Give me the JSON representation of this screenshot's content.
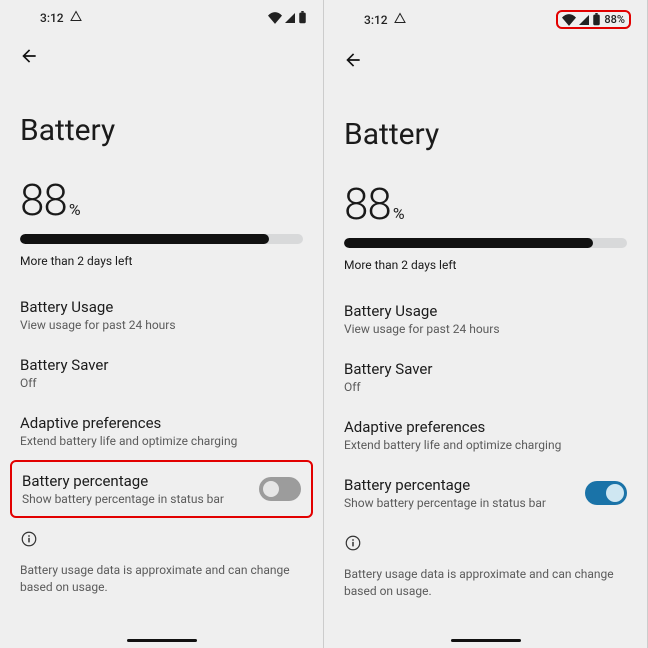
{
  "statusbar": {
    "time": "3:12",
    "battery_pct_text": "88%"
  },
  "page": {
    "title": "Battery",
    "pct_value": "88",
    "pct_symbol": "%",
    "bar_pct": 88,
    "estimate": "More than 2 days left"
  },
  "rows": {
    "usage": {
      "title": "Battery Usage",
      "sub": "View usage for past 24 hours"
    },
    "saver": {
      "title": "Battery Saver",
      "sub": "Off"
    },
    "adaptive": {
      "title": "Adaptive preferences",
      "sub": "Extend battery life and optimize charging"
    },
    "pct_toggle": {
      "title": "Battery percentage",
      "sub": "Show battery percentage in status bar"
    }
  },
  "footer": "Battery usage data is approximate and can change based on usage."
}
